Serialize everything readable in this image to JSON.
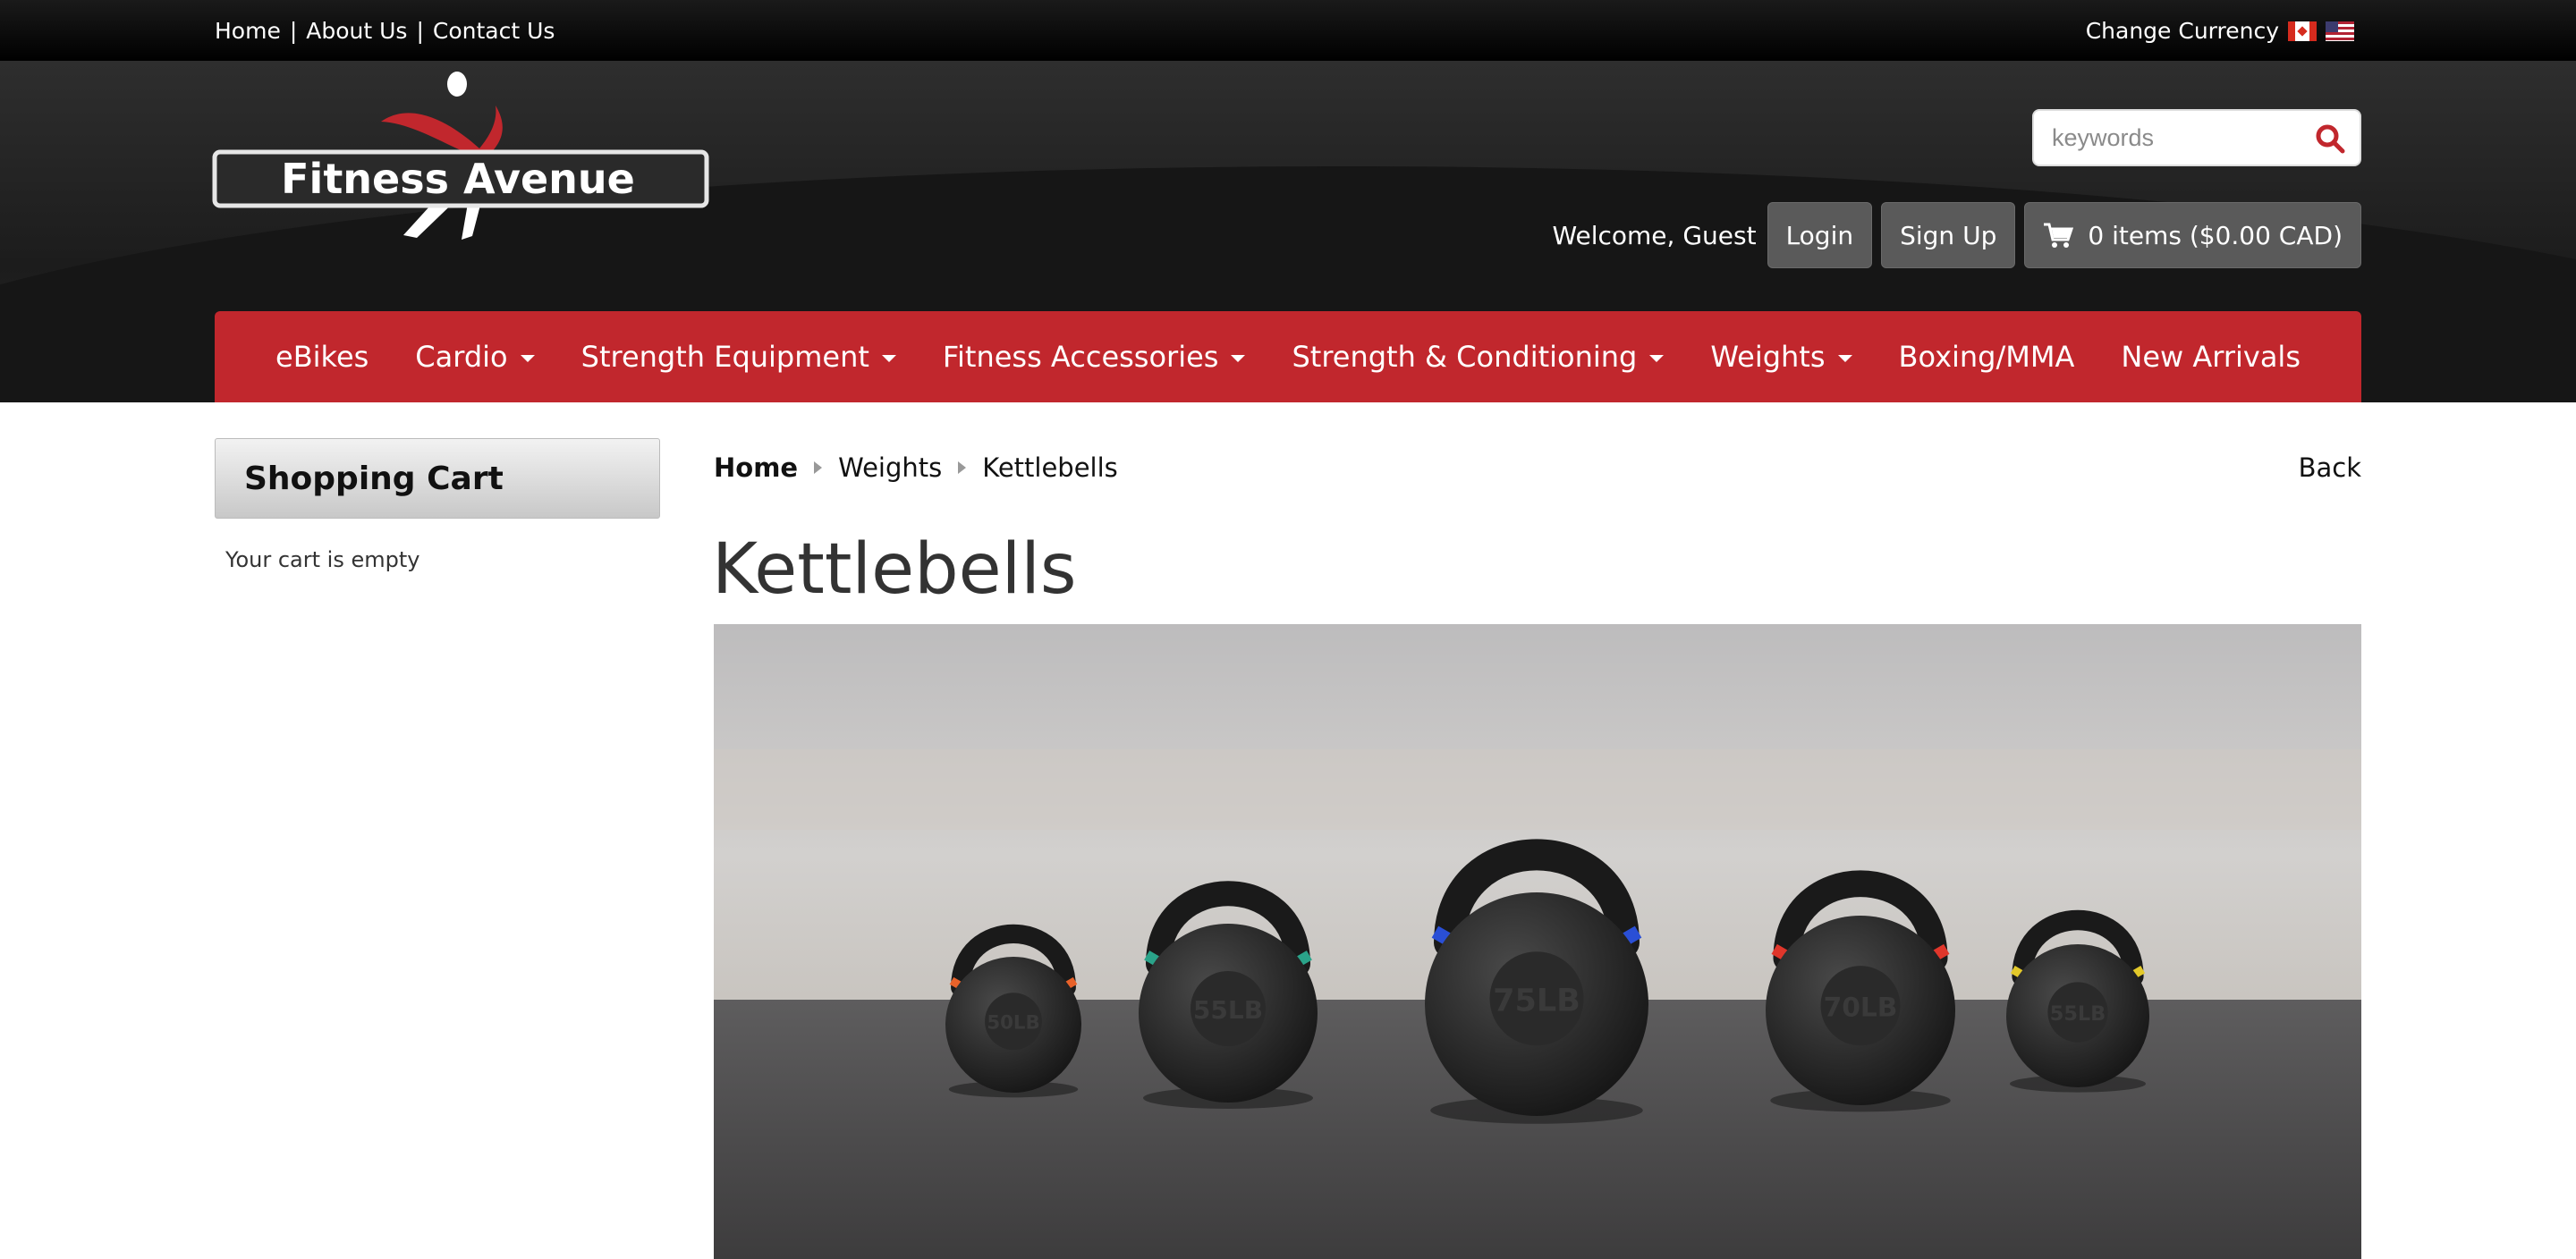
{
  "topbar": {
    "links": [
      "Home",
      "About Us",
      "Contact Us"
    ],
    "currency_label": "Change Currency",
    "flags": [
      "canada-flag-icon",
      "us-flag-icon"
    ]
  },
  "header": {
    "logo_text": "Fitness Avenue",
    "search": {
      "placeholder": "keywords",
      "value": ""
    },
    "welcome": "Welcome, Guest",
    "login_label": "Login",
    "signup_label": "Sign Up",
    "cart_label": "0 items ($0.00 CAD)"
  },
  "nav": {
    "items": [
      {
        "label": "eBikes",
        "dropdown": false
      },
      {
        "label": "Cardio",
        "dropdown": true
      },
      {
        "label": "Strength Equipment",
        "dropdown": true
      },
      {
        "label": "Fitness Accessories",
        "dropdown": true
      },
      {
        "label": "Strength & Conditioning",
        "dropdown": true
      },
      {
        "label": "Weights",
        "dropdown": true
      },
      {
        "label": "Boxing/MMA",
        "dropdown": false
      },
      {
        "label": "New Arrivals",
        "dropdown": false
      }
    ]
  },
  "sidebar": {
    "title": "Shopping Cart",
    "empty_text": "Your cart is empty"
  },
  "main": {
    "breadcrumb": [
      "Home",
      "Weights",
      "Kettlebells"
    ],
    "back_label": "Back",
    "title": "Kettlebells",
    "hero_kettlebells": [
      {
        "label": "50LB",
        "band_color": "#e8622a"
      },
      {
        "label": "55LB",
        "band_color": "#2aa389"
      },
      {
        "label": "75LB",
        "band_color": "#2a4fd6"
      },
      {
        "label": "70LB",
        "band_color": "#e0362b"
      },
      {
        "label": "55LB",
        "band_color": "#e3c92a"
      }
    ]
  },
  "colors": {
    "accent": "#c1272d",
    "topbar": "#000000",
    "header": "#262626"
  }
}
